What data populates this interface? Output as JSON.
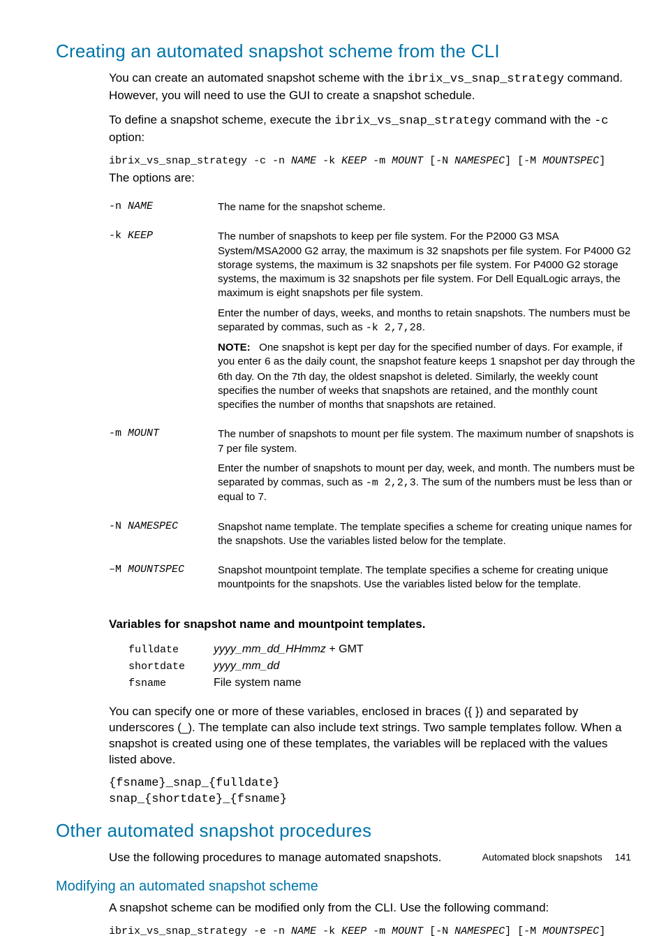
{
  "sec1": {
    "title": "Creating an automated snapshot scheme from the CLI",
    "p1a": "You can create an automated snapshot scheme with the ",
    "p1b": "ibrix_vs_snap_strategy",
    "p1c": " command. However, you will need to use the GUI to create a snapshot schedule.",
    "p2a": "To define a snapshot scheme, execute the ",
    "p2b": "ibrix_vs_snap_strategy",
    "p2c": " command with the ",
    "p2d": "-c",
    "p2e": " option:",
    "cmd1a": "ibrix_vs_snap_strategy -c -n ",
    "cmd1b": "NAME",
    "cmd1c": " -k ",
    "cmd1d": "KEEP",
    "cmd1e": " -m ",
    "cmd1f": "MOUNT",
    "cmd1g": " [-N ",
    "cmd1h": "NAMESPEC",
    "cmd1i": "] [-M ",
    "cmd1j": "MOUNTSPEC",
    "cmd1k": "]",
    "p3": "The options are:"
  },
  "opts": {
    "r1_flag": "-n ",
    "r1_arg": "NAME",
    "r1_desc": "The name for the snapshot scheme.",
    "r2_flag": "-k ",
    "r2_arg": "KEEP",
    "r2_desc1": "The number of snapshots to keep per file system. For the P2000 G3 MSA System/MSA2000 G2 array, the maximum is 32 snapshots per file system. For P4000 G2 storage systems, the maximum is 32 snapshots per file system. For P4000 G2 storage systems, the maximum is 32 snapshots per file system. For Dell EqualLogic arrays, the maximum is eight snapshots per file system.",
    "r2_desc2a": "Enter the number of days, weeks, and months to retain snapshots. The numbers must be separated by commas, such as ",
    "r2_desc2b": "-k 2,7,28",
    "r2_desc2c": ".",
    "r2_note_label": "NOTE:",
    "r2_note_a": "   One snapshot is kept per day for the specified number of days. For example, if you enter ",
    "r2_note_b": "6",
    "r2_note_c": " as the daily count, the snapshot feature keeps 1 snapshot per day through the 6th day. On the 7th day, the oldest snapshot is deleted. Similarly, the weekly count specifies the number of weeks that snapshots are retained, and the monthly count specifies the number of months that snapshots are retained.",
    "r3_flag": "-m ",
    "r3_arg": "MOUNT",
    "r3_desc1": "The number of snapshots to mount per file system. The maximum number of snapshots is 7 per file system.",
    "r3_desc2a": "Enter the number of snapshots to mount per day, week, and month. The numbers must be separated by commas, such as ",
    "r3_desc2b": "-m 2,2,3",
    "r3_desc2c": ". The sum of the numbers must be less than or equal to 7.",
    "r4_flag": "-N ",
    "r4_arg": "NAMESPEC",
    "r4_desc": "Snapshot name template. The template specifies a scheme for creating unique names for the snapshots. Use the variables listed below for the template.",
    "r5_flag": "–M ",
    "r5_arg": "MOUNTSPEC",
    "r5_desc": "Snapshot mountpoint template. The template specifies a scheme for creating unique mountpoints for the snapshots. Use the variables listed below for the template."
  },
  "vars": {
    "title": "Variables for snapshot name and mountpoint templates.",
    "r1_l": "fulldate",
    "r1_r_it": "yyyy_mm_dd_HHmmz",
    "r1_r_tx": " + GMT",
    "r2_l": "shortdate",
    "r2_r_it": "yyyy_mm_dd",
    "r3_l": "fsname",
    "r3_r": "File system name",
    "post": "You can specify one or more of these variables, enclosed in braces ({ }) and separated by underscores (_). The template can also include text strings. Two sample templates follow. When a snapshot is created using one of these templates, the variables will be replaced with the values listed above.",
    "sample": "{fsname}_snap_{fulldate}\nsnap_{shortdate}_{fsname}"
  },
  "sec2": {
    "title": "Other automated snapshot procedures",
    "p1": "Use the following procedures to manage automated snapshots."
  },
  "sec3": {
    "title": "Modifying an automated snapshot scheme",
    "p1": "A snapshot scheme can be modified only from the CLI. Use the following command:",
    "cmd_a": "ibrix_vs_snap_strategy -e -n ",
    "cmd_b": "NAME",
    "cmd_c": " -k ",
    "cmd_d": "KEEP",
    "cmd_e": " -m ",
    "cmd_f": "MOUNT",
    "cmd_g": " [-N ",
    "cmd_h": "NAMESPEC",
    "cmd_i": "] [-M ",
    "cmd_j": "MOUNTSPEC",
    "cmd_k": "]"
  },
  "footer": {
    "section": "Automated block snapshots",
    "page": "141"
  }
}
